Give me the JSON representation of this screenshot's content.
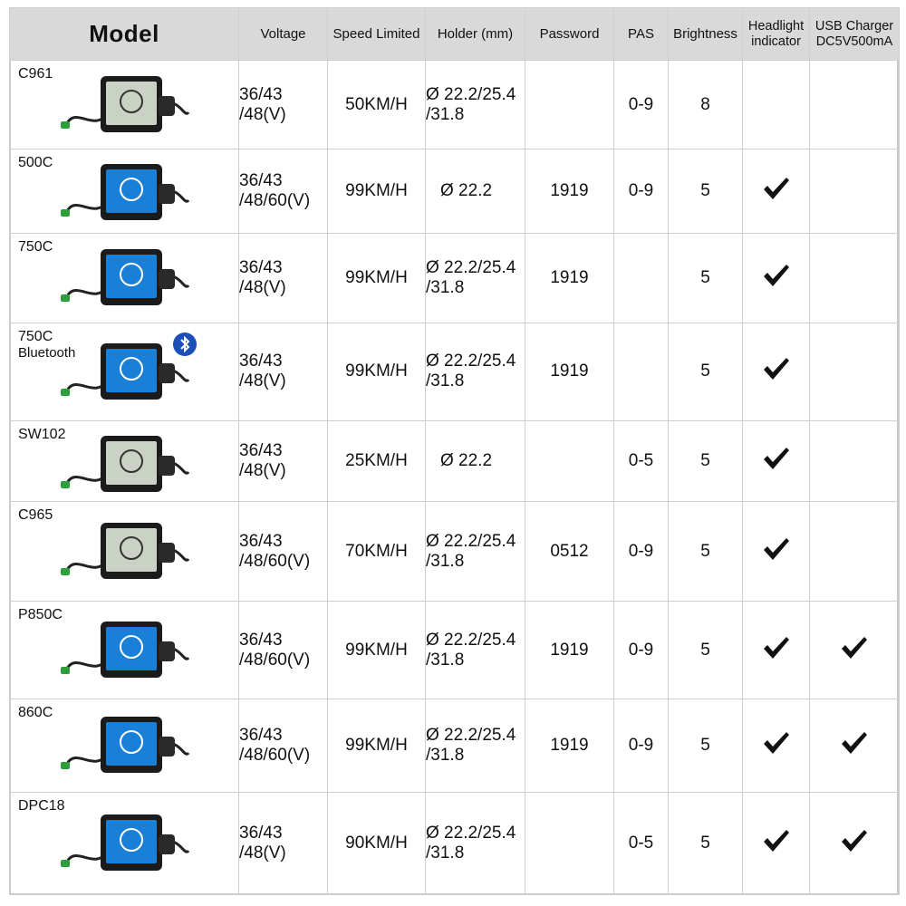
{
  "headers": {
    "model": "Model",
    "voltage": "Voltage",
    "speed": "Speed Limited",
    "holder": "Holder (mm)",
    "password": "Password",
    "pas": "PAS",
    "brightness": "Brightness",
    "headlight_1": "Headlight",
    "headlight_2": "indicator",
    "usb_1": "USB Charger",
    "usb_2": "DC5V500mA"
  },
  "rows": [
    {
      "model": "C961",
      "model_sub": "",
      "volt1": "36/43",
      "volt2": "/48(V)",
      "speed": "50KM/H",
      "holder1": "Ø 22.2/25.4",
      "holder2": "/31.8",
      "password": "",
      "pas": "0-9",
      "brightness": "8",
      "headlight": false,
      "usb": false,
      "screen": "mono"
    },
    {
      "model": "500C",
      "model_sub": "",
      "volt1": "36/43",
      "volt2": "/48/60(V)",
      "speed": "99KM/H",
      "holder1": "Ø 22.2",
      "holder2": "",
      "password": "1919",
      "pas": "0-9",
      "brightness": "5",
      "headlight": true,
      "usb": false,
      "screen": "color"
    },
    {
      "model": "750C",
      "model_sub": "",
      "volt1": "36/43",
      "volt2": "/48(V)",
      "speed": "99KM/H",
      "holder1": "Ø 22.2/25.4",
      "holder2": "/31.8",
      "password": "1919",
      "pas": "",
      "brightness": "5",
      "headlight": true,
      "usb": false,
      "screen": "color"
    },
    {
      "model": "750C",
      "model_sub": "Bluetooth",
      "volt1": "36/43",
      "volt2": "/48(V)",
      "speed": "99KM/H",
      "holder1": "Ø 22.2/25.4",
      "holder2": "/31.8",
      "password": "1919",
      "pas": "",
      "brightness": "5",
      "headlight": true,
      "usb": false,
      "screen": "color"
    },
    {
      "model": "SW102",
      "model_sub": "",
      "volt1": "36/43",
      "volt2": "/48(V)",
      "speed": "25KM/H",
      "holder1": "Ø 22.2",
      "holder2": "",
      "password": "",
      "pas": "0-5",
      "brightness": "5",
      "headlight": true,
      "usb": false,
      "screen": "mono"
    },
    {
      "model": "C965",
      "model_sub": "",
      "volt1": "36/43",
      "volt2": "/48/60(V)",
      "speed": "70KM/H",
      "holder1": "Ø 22.2/25.4",
      "holder2": "/31.8",
      "password": "0512",
      "pas": "0-9",
      "brightness": "5",
      "headlight": true,
      "usb": false,
      "screen": "mono"
    },
    {
      "model": "P850C",
      "model_sub": "",
      "volt1": "36/43",
      "volt2": "/48/60(V)",
      "speed": "99KM/H",
      "holder1": "Ø 22.2/25.4",
      "holder2": "/31.8",
      "password": "1919",
      "pas": "0-9",
      "brightness": "5",
      "headlight": true,
      "usb": true,
      "screen": "color"
    },
    {
      "model": "860C",
      "model_sub": "",
      "volt1": "36/43",
      "volt2": "/48/60(V)",
      "speed": "99KM/H",
      "holder1": "Ø 22.2/25.4",
      "holder2": "/31.8",
      "password": "1919",
      "pas": "0-9",
      "brightness": "5",
      "headlight": true,
      "usb": true,
      "screen": "color"
    },
    {
      "model": "DPC18",
      "model_sub": "",
      "volt1": "36/43",
      "volt2": "/48(V)",
      "speed": "90KM/H",
      "holder1": "Ø 22.2/25.4",
      "holder2": "/31.8",
      "password": "",
      "pas": "0-5",
      "brightness": "5",
      "headlight": true,
      "usb": true,
      "screen": "color"
    }
  ],
  "icons": {
    "check": "checkmark-icon",
    "device": "display-unit-icon",
    "bluetooth": "bluetooth-icon"
  },
  "colors": {
    "header_bg": "#d9d9d9",
    "grid": "#cfcfcf",
    "check": "#111111",
    "bluetooth": "#1e4fb8",
    "screen_color": "#1a7fd6",
    "screen_mono": "#c9d2c4"
  }
}
